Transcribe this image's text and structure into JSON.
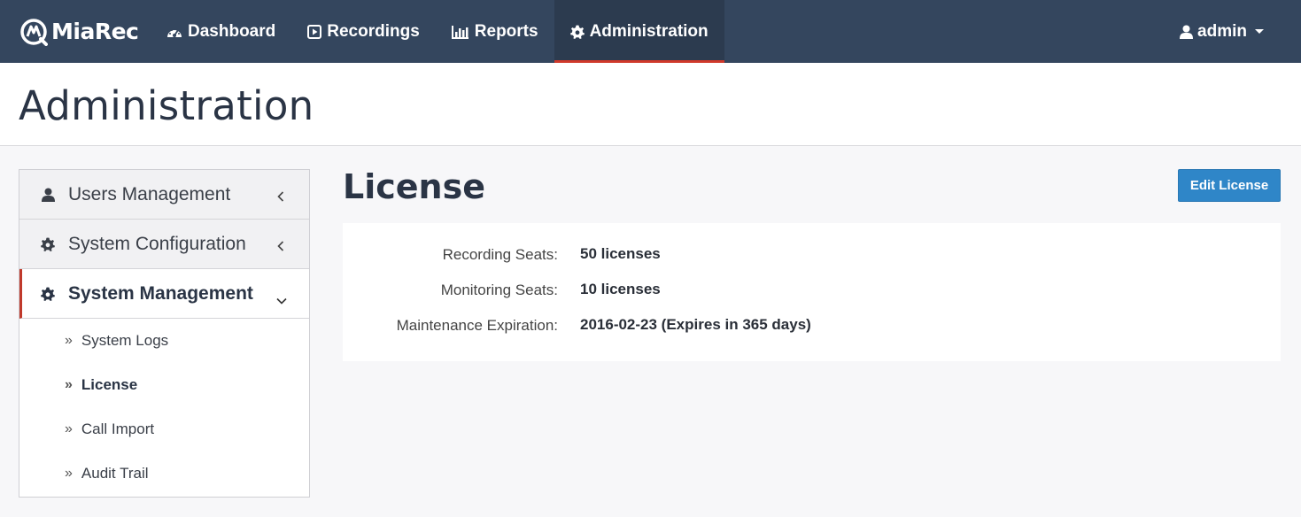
{
  "brand": {
    "name": "MiaRec"
  },
  "nav": {
    "items": [
      {
        "label": "Dashboard",
        "icon": "dashboard-icon"
      },
      {
        "label": "Recordings",
        "icon": "play-square-icon"
      },
      {
        "label": "Reports",
        "icon": "bar-chart-icon"
      },
      {
        "label": "Administration",
        "icon": "gear-icon",
        "active": true
      }
    ],
    "user": {
      "label": "admin",
      "icon": "user-icon"
    }
  },
  "page": {
    "title": "Administration"
  },
  "sidebar": {
    "items": [
      {
        "label": "Users Management",
        "icon": "user-icon",
        "chevron": "‹"
      },
      {
        "label": "System Configuration",
        "icon": "gear-icon",
        "chevron": "‹"
      },
      {
        "label": "System Management",
        "icon": "gear-icon",
        "chevron": "⌄",
        "active": true
      }
    ],
    "subitems": [
      {
        "label": "System Logs"
      },
      {
        "label": "License",
        "current": true
      },
      {
        "label": "Call Import"
      },
      {
        "label": "Audit Trail"
      }
    ],
    "sub_marker": "»"
  },
  "content": {
    "title": "License",
    "edit_button": "Edit License",
    "fields": [
      {
        "label": "Recording Seats:",
        "value": "50 licenses"
      },
      {
        "label": "Monitoring Seats:",
        "value": "10 licenses"
      },
      {
        "label": "Maintenance Expiration:",
        "value": "2016-02-23 (Expires in 365 days)"
      }
    ]
  },
  "colors": {
    "navbar": "#34465e",
    "accent_red": "#c0392b",
    "button_blue": "#2f86c8"
  }
}
